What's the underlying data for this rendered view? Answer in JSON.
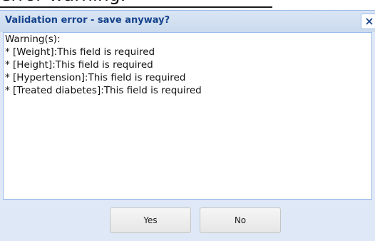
{
  "background": {
    "fragment_text": "error warning."
  },
  "dialog": {
    "title": "Validation error - save anyway?",
    "close_glyph": "x",
    "close_icon": "close-icon",
    "warnings_heading": "Warning(s):",
    "warnings": [
      "* [Weight]:This field is required",
      "* [Height]:This field is required",
      "* [Hypertension]:This field is required",
      "* [Treated diabetes]:This field is required"
    ],
    "buttons": {
      "yes_label": "Yes",
      "no_label": "No"
    }
  },
  "colors": {
    "title_text": "#15428b",
    "dialog_background": "#dfe8f6",
    "border": "#99bbe8"
  }
}
